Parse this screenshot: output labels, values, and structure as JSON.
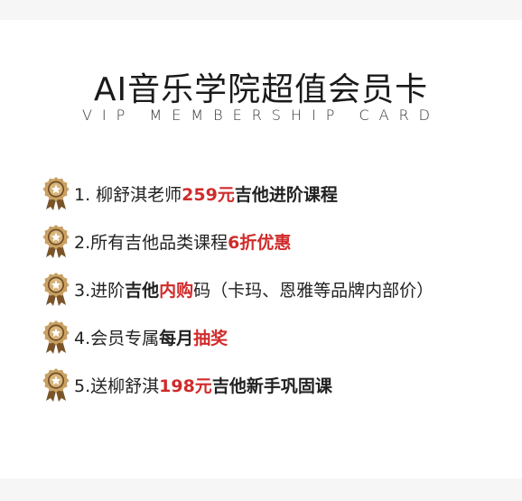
{
  "title": "AI音乐学院超值会员卡",
  "subtitle": "VIP MEMBERSHIP CARD",
  "colors": {
    "accent_red": "#d02b2b",
    "medal_gold": "#c8a062",
    "medal_dark": "#6b4a24"
  },
  "items": [
    {
      "icon": "gold-medal-star-icon",
      "parts": [
        {
          "t": "1.  柳舒淇老师"
        },
        {
          "t": "259元",
          "s": "r"
        },
        {
          "t": "吉他进阶课程",
          "s": "b"
        }
      ]
    },
    {
      "icon": "gold-medal-star-icon",
      "parts": [
        {
          "t": "2.所有吉他品类课程"
        },
        {
          "t": "6折优惠",
          "s": "r"
        }
      ]
    },
    {
      "icon": "gold-medal-star-icon",
      "parts": [
        {
          "t": "3.进阶"
        },
        {
          "t": "吉他",
          "s": "b"
        },
        {
          "t": "内购",
          "s": "r"
        },
        {
          "t": "码（卡玛、恩雅等品牌内部价）"
        }
      ]
    },
    {
      "icon": "gold-medal-star-icon",
      "parts": [
        {
          "t": "4.会员专属"
        },
        {
          "t": "每月",
          "s": "b"
        },
        {
          "t": "抽奖",
          "s": "r"
        }
      ]
    },
    {
      "icon": "gold-medal-star-icon",
      "parts": [
        {
          "t": "5.送柳舒淇"
        },
        {
          "t": "198元",
          "s": "r"
        },
        {
          "t": "吉他新手巩固课",
          "s": "b"
        }
      ]
    }
  ]
}
